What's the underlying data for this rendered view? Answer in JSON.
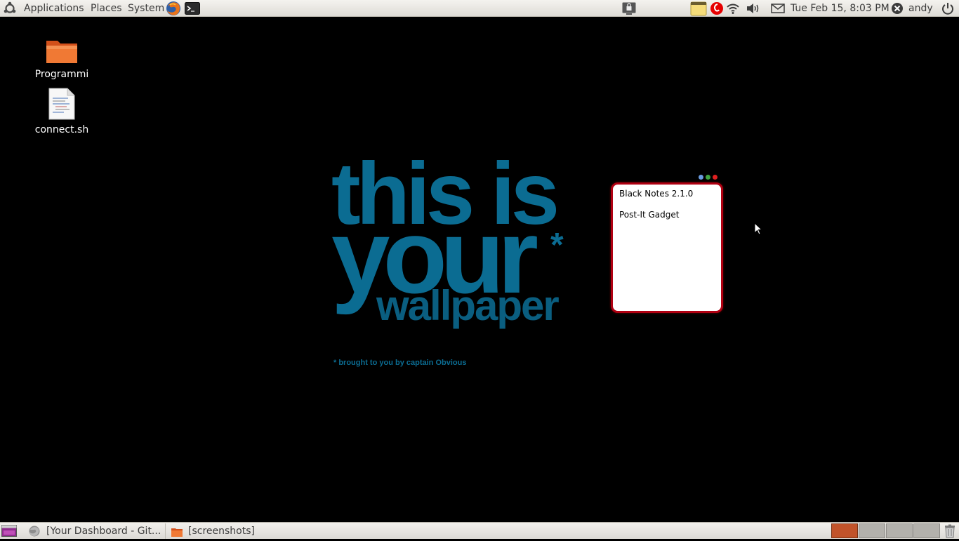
{
  "top_panel": {
    "menus": [
      "Applications",
      "Places",
      "System"
    ],
    "clock": "Tue Feb 15,  8:03 PM",
    "user": "andy"
  },
  "desktop": {
    "icons": [
      {
        "label": "Programmi",
        "type": "folder"
      },
      {
        "label": "connect.sh",
        "type": "script-file"
      }
    ]
  },
  "wallpaper": {
    "line1": "this is",
    "line2": "your",
    "star": "*",
    "line3": "wallpaper",
    "credit": "* brought to you by captain Obvious"
  },
  "gadget": {
    "title": "Black Notes 2.1.0",
    "body": "Post-It Gadget",
    "border_color": "#b00012"
  },
  "taskbar": {
    "tasks": [
      {
        "label": "[Your Dashboard - Git...",
        "icon": "firefox-icon"
      },
      {
        "label": "[screenshots]",
        "icon": "folder-icon"
      }
    ],
    "workspaces": 4
  }
}
